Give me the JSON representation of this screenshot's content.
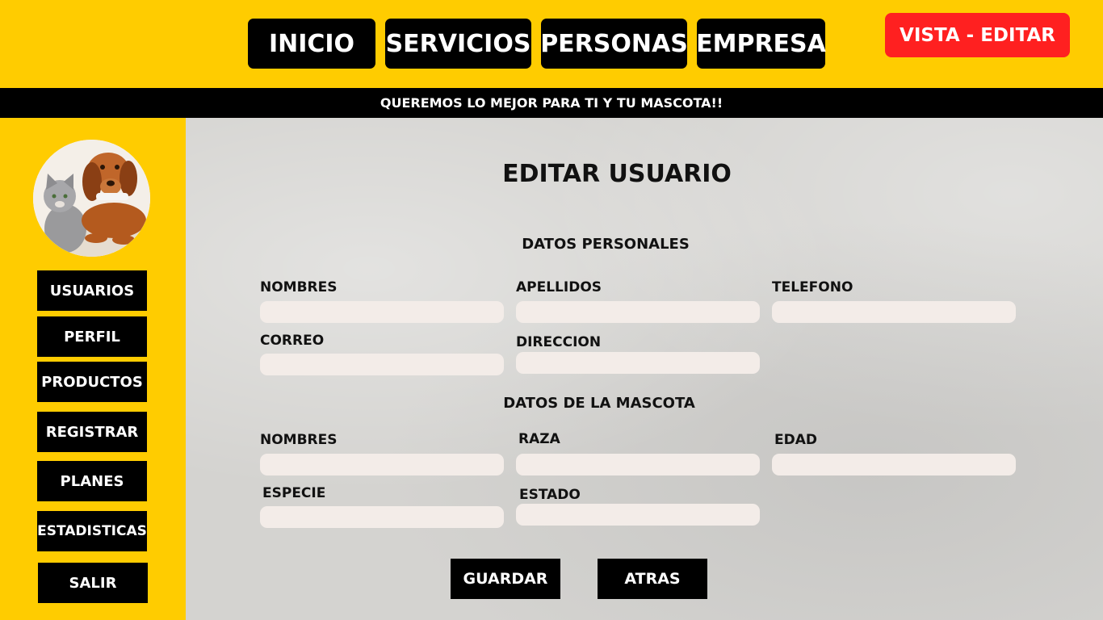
{
  "nav": {
    "items": [
      {
        "label": "INICIO"
      },
      {
        "label": "SERVICIOS"
      },
      {
        "label": "PERSONAS"
      },
      {
        "label": "EMPRESA"
      }
    ],
    "vista_label": "VISTA - EDITAR"
  },
  "tagline": "QUEREMOS LO MEJOR PARA TI Y TU MASCOTA!!",
  "sidebar": {
    "items": [
      {
        "label": "USUARIOS"
      },
      {
        "label": "PERFIL"
      },
      {
        "label": "PRODUCTOS"
      },
      {
        "label": "REGISTRAR"
      },
      {
        "label": "PLANES"
      },
      {
        "label": "ESTADISTICAS"
      },
      {
        "label": "SALIR"
      }
    ]
  },
  "form": {
    "title": "EDITAR USUARIO",
    "personal": {
      "heading": "DATOS PERSONALES",
      "nombres": {
        "label": "NOMBRES",
        "value": ""
      },
      "apellidos": {
        "label": "APELLIDOS",
        "value": ""
      },
      "telefono": {
        "label": "TELEFONO",
        "value": ""
      },
      "correo": {
        "label": "CORREO",
        "value": ""
      },
      "direccion": {
        "label": "DIRECCION",
        "value": ""
      }
    },
    "pet": {
      "heading": "DATOS DE LA MASCOTA",
      "nombres": {
        "label": "NOMBRES",
        "value": ""
      },
      "raza": {
        "label": "RAZA",
        "value": ""
      },
      "edad": {
        "label": "EDAD",
        "value": ""
      },
      "especie": {
        "label": "ESPECIE",
        "value": ""
      },
      "estado": {
        "label": "ESTADO",
        "value": ""
      }
    },
    "save_label": "GUARDAR",
    "back_label": "ATRAS"
  },
  "colors": {
    "accent": "#ffcc00",
    "dark": "#000000",
    "alert": "#ff2020",
    "field": "#f3ece8"
  }
}
